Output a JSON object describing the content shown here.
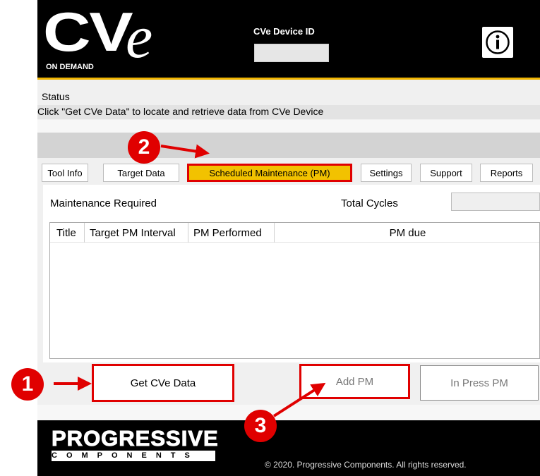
{
  "header": {
    "logo_main": "CV",
    "logo_e": "e",
    "logo_sub": "ON DEMAND",
    "device_id_label": "CVe Device ID",
    "device_id_value": "",
    "info_icon": "info-circle-icon"
  },
  "status": {
    "label": "Status",
    "message": "Click \"Get CVe Data\" to locate and retrieve data from CVe Device"
  },
  "tabs": [
    {
      "label": "Tool Info",
      "active": false
    },
    {
      "label": "Target Data",
      "active": false
    },
    {
      "label": "Scheduled Maintenance (PM)",
      "active": true
    },
    {
      "label": "Settings",
      "active": false
    },
    {
      "label": "Support",
      "active": false
    },
    {
      "label": "Reports",
      "active": false
    }
  ],
  "maintenance": {
    "required_label": "Maintenance Required",
    "total_cycles_label": "Total Cycles",
    "total_cycles_value": "",
    "columns": [
      "Title",
      "Target PM Interval",
      "PM Performed",
      "PM due"
    ],
    "rows": []
  },
  "buttons": {
    "get_data": "Get CVe Data",
    "add_pm": "Add PM",
    "in_press_pm": "In Press PM"
  },
  "footer": {
    "brand": "PROGRESSIVE",
    "brand_sub": "COMPONENTS",
    "copyright": "© 2020. Progressive Components. All rights reserved."
  },
  "callouts": [
    "1",
    "2",
    "3"
  ],
  "colors": {
    "accent_yellow": "#F2C200",
    "callout_red": "#E00000",
    "header_black": "#000000"
  }
}
